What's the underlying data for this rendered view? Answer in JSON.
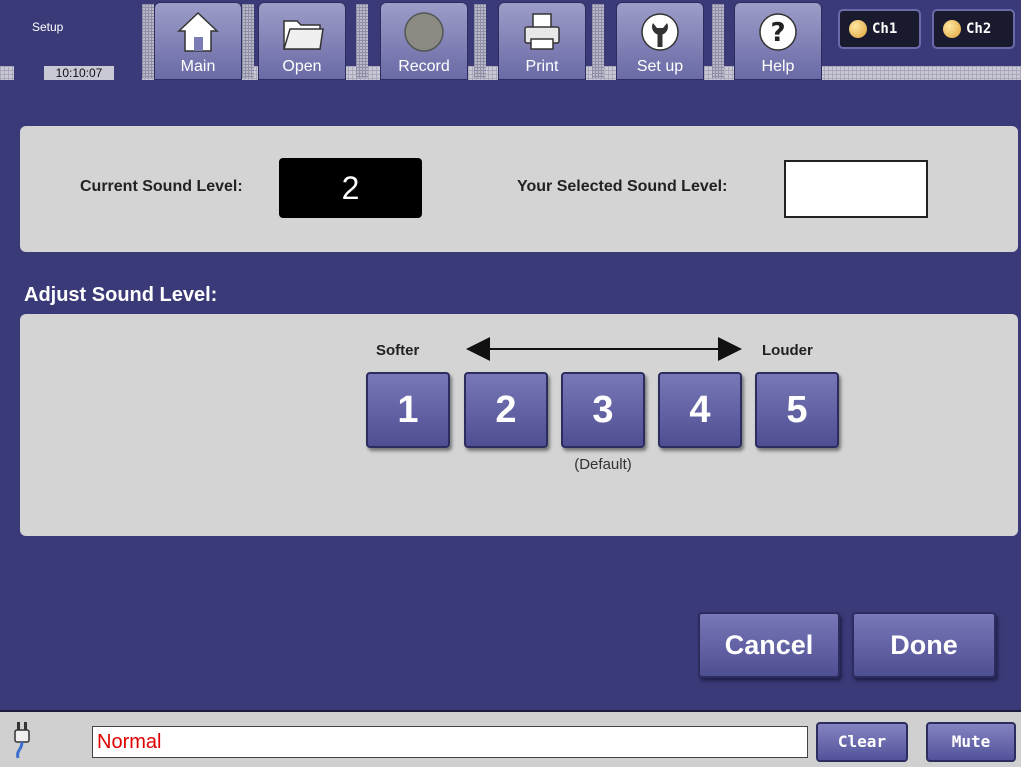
{
  "app": {
    "screen_title": "Setup",
    "time": "10:10:07"
  },
  "toolbar": {
    "tabs": [
      {
        "label": "Main",
        "icon": "home-icon"
      },
      {
        "label": "Open",
        "icon": "folder-icon"
      },
      {
        "label": "Record",
        "icon": "record-icon"
      },
      {
        "label": "Print",
        "icon": "printer-icon"
      },
      {
        "label": "Set up",
        "icon": "wrench-icon"
      },
      {
        "label": "Help",
        "icon": "help-icon"
      }
    ],
    "channels": [
      {
        "label": "Ch1"
      },
      {
        "label": "Ch2"
      }
    ]
  },
  "sound": {
    "current_label": "Current Sound Level:",
    "current_value": "2",
    "selected_label": "Your Selected Sound Level:",
    "selected_value": ""
  },
  "adjust": {
    "title": "Adjust Sound Level:",
    "softer": "Softer",
    "louder": "Louder",
    "levels": [
      "1",
      "2",
      "3",
      "4",
      "5"
    ],
    "default_note": "(Default)"
  },
  "actions": {
    "cancel": "Cancel",
    "done": "Done"
  },
  "statusbar": {
    "status_text": "Normal",
    "clear": "Clear",
    "mute": "Mute",
    "icon": "power-plug-icon"
  },
  "colors": {
    "background": "#3a3a78",
    "panel": "#d4d4d4",
    "button": "#6a6aa6",
    "status_text": "#e00000"
  }
}
